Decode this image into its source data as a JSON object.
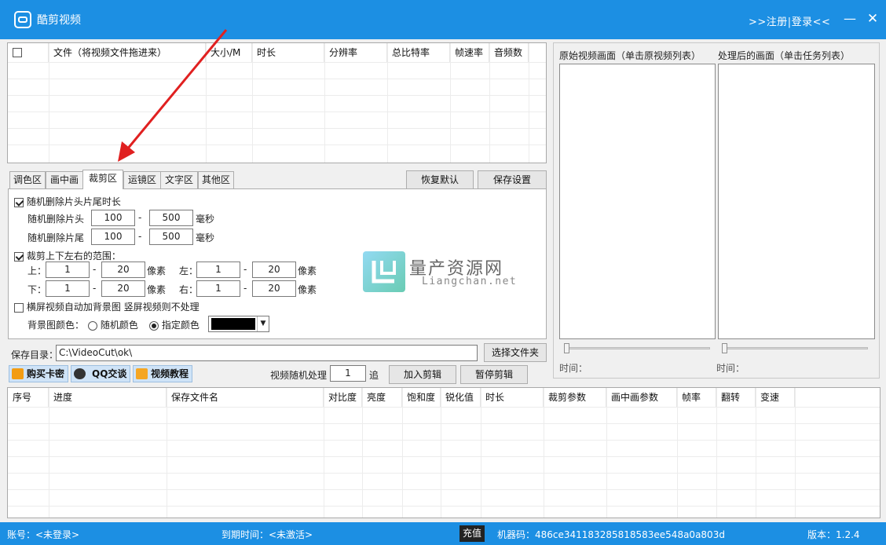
{
  "titlebar": {
    "title": "酷剪视频",
    "login_link": ">>注册|登录<<",
    "minimize_icon": "minimize-icon",
    "close_icon": "close-icon",
    "color": "#1c8fe3"
  },
  "file_table": {
    "headers": [
      "文件（将视频文件拖进来）",
      "大小/M",
      "时长",
      "分辨率",
      "总比特率",
      "帧速率",
      "音频数"
    ],
    "rows": []
  },
  "tabs": {
    "items": [
      "调色区",
      "画中画",
      "裁剪区",
      "运镜区",
      "文字区",
      "其他区"
    ],
    "active": "裁剪区"
  },
  "buttons": {
    "restore_default": "恢复默认",
    "save_settings": "保存设置",
    "choose_folder": "选择文件夹",
    "add_edit": "加入剪辑",
    "pause_edit": "暂停剪辑"
  },
  "crop_panel": {
    "random_trim_label": "随机删除片头片尾时长",
    "random_trim_checked": true,
    "head_label": "随机删除片头",
    "head_min": "100",
    "head_max": "500",
    "tail_label": "随机删除片尾",
    "tail_min": "100",
    "tail_max": "500",
    "dash": "-",
    "ms_unit": "毫秒",
    "crop_range_label": "裁剪上下左右的范围：",
    "crop_range_checked": true,
    "top_label": "上：",
    "top_min": "1",
    "top_max": "20",
    "left_label": "左：",
    "left_min": "1",
    "left_max": "20",
    "bottom_label": "下：",
    "bottom_min": "1",
    "bottom_max": "20",
    "right_label": "右：",
    "right_min": "1",
    "right_max": "20",
    "px_unit": "像素",
    "bg_label": "横屏视频自动加背景图 竖屏视频则不处理",
    "bg_checked": false,
    "bg_color_label": "背景图颜色：",
    "random_color": "随机颜色",
    "specified_color": "指定颜色",
    "selected_radio": "指定颜色",
    "color_value": "#000000"
  },
  "save_dir": {
    "label": "保存目录：",
    "value": "C:\\VideoCut\\ok\\"
  },
  "toolbar": {
    "buy_key": "购买卡密",
    "qq_chat": "QQ交谈",
    "video_tutorial": "视频教程",
    "random_process_label": "视频随机处理",
    "random_process_value": "1",
    "times_unit": "追"
  },
  "preview": {
    "original_label": "原始视频画面（单击原视频列表）",
    "processed_label": "处理后的画面（单击任务列表）",
    "time_label_left": "时间：",
    "time_label_right": "时间："
  },
  "task_table": {
    "headers": [
      "序号",
      "进度",
      "保存文件名",
      "对比度",
      "亮度",
      "饱和度",
      "锐化值",
      "时长",
      "裁剪参数",
      "画中画参数",
      "帧率",
      "翻转",
      "变速"
    ],
    "rows": []
  },
  "statusbar": {
    "account": "账号：<未登录>",
    "expire": "到期时间：<未激活>",
    "recharge": "充值",
    "machine_code": "机器码：486ce341183285818583ee548a0a803d",
    "version": "版本：1.2.4"
  },
  "watermark": {
    "title": "量产资源网",
    "subtitle": "Liangchan.net"
  }
}
